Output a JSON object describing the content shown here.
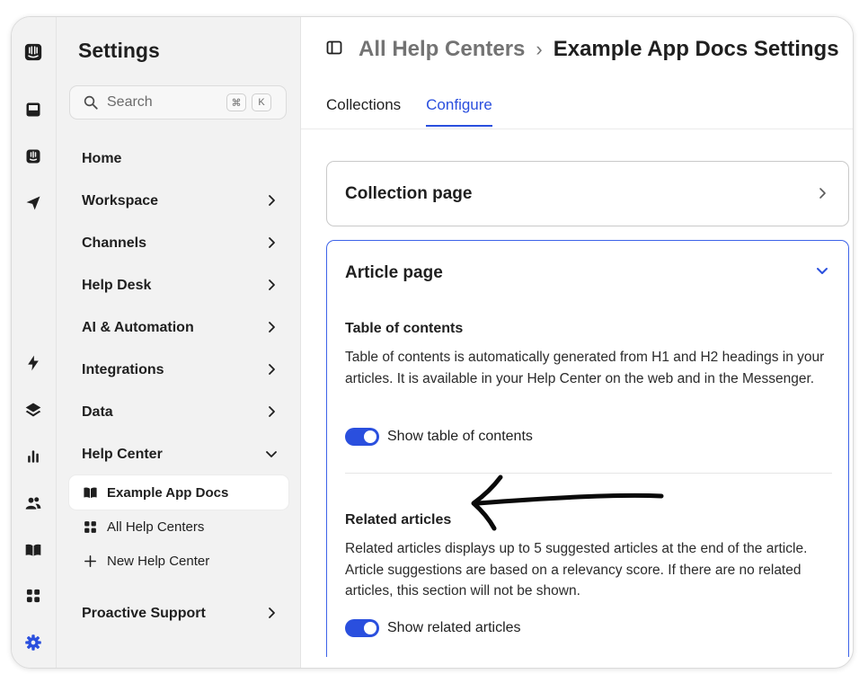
{
  "accent_color": "#2a4fde",
  "rail": {
    "icons": [
      "intercom-logo-icon",
      "inbox-icon",
      "fin-icon",
      "outbound-icon",
      "bolt-icon",
      "layers-icon",
      "reports-icon",
      "contacts-icon",
      "knowledge-icon",
      "apps-icon",
      "settings-gear-icon"
    ]
  },
  "sidebar": {
    "title": "Settings",
    "search": {
      "placeholder": "Search",
      "shortcut_1": "⌘",
      "shortcut_2": "K"
    },
    "items": [
      {
        "label": "Home",
        "has_chevron": false
      },
      {
        "label": "Workspace",
        "has_chevron": true
      },
      {
        "label": "Channels",
        "has_chevron": true
      },
      {
        "label": "Help Desk",
        "has_chevron": true
      },
      {
        "label": "AI & Automation",
        "has_chevron": true
      },
      {
        "label": "Integrations",
        "has_chevron": true
      },
      {
        "label": "Data",
        "has_chevron": true
      },
      {
        "label": "Help Center",
        "expanded": true
      }
    ],
    "help_center_sub": [
      {
        "label": "Example App Docs",
        "icon": "book-icon",
        "active": true
      },
      {
        "label": "All Help Centers",
        "icon": "grid-icon",
        "active": false
      },
      {
        "label": "New Help Center",
        "icon": "plus-icon",
        "active": false
      }
    ],
    "last_item": {
      "label": "Proactive Support"
    }
  },
  "header": {
    "breadcrumb_link": "All Help Centers",
    "separator": "›",
    "current": "Example App Docs Settings"
  },
  "tabs": [
    {
      "label": "Collections",
      "active": false
    },
    {
      "label": "Configure",
      "active": true
    }
  ],
  "collection_card": {
    "title": "Collection page",
    "expanded": false
  },
  "article_card": {
    "title": "Article page",
    "expanded": true,
    "toc": {
      "title": "Table of contents",
      "description": "Table of contents is automatically generated from H1 and H2 headings in your articles. It is available in your Help Center on the web and in the Messenger.",
      "toggle_label": "Show table of contents",
      "toggle_on": true
    },
    "related": {
      "title": "Related articles",
      "description": "Related articles displays up to 5 suggested articles at the end of the article. Article suggestions are based on a relevancy score. If there are no related articles, this section will not be shown.",
      "toggle_label": "Show related articles",
      "toggle_on": true
    }
  }
}
